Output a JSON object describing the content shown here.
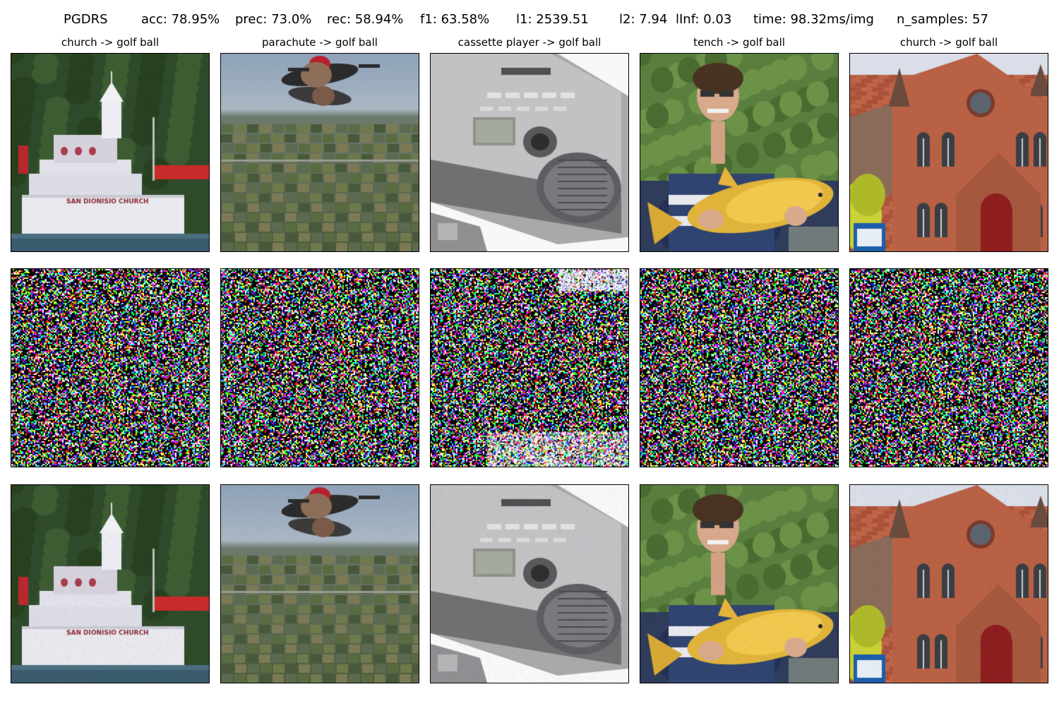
{
  "figure": {
    "method": "PGDRS",
    "metrics": {
      "acc": "acc: 78.95%",
      "prec": "prec: 73.0%",
      "rec": "rec: 58.94%",
      "f1": "f1: 63.58%",
      "l1": "l1: 2539.51",
      "l2": "l2: 7.94",
      "linf": "lInf: 0.03",
      "time": "time: 98.32ms/img",
      "n_samples": "n_samples: 57"
    }
  },
  "columns": [
    {
      "title": "church -> golf ball",
      "scene": "island-church"
    },
    {
      "title": "parachute -> golf ball",
      "scene": "skydivers-over-fields"
    },
    {
      "title": "cassette player -> golf ball",
      "scene": "silver-boombox"
    },
    {
      "title": "tench -> golf ball",
      "scene": "boy-holding-golden-fish"
    },
    {
      "title": "church -> golf ball",
      "scene": "red-brick-church"
    }
  ],
  "rows": [
    "original",
    "perturbation",
    "adversarial"
  ]
}
